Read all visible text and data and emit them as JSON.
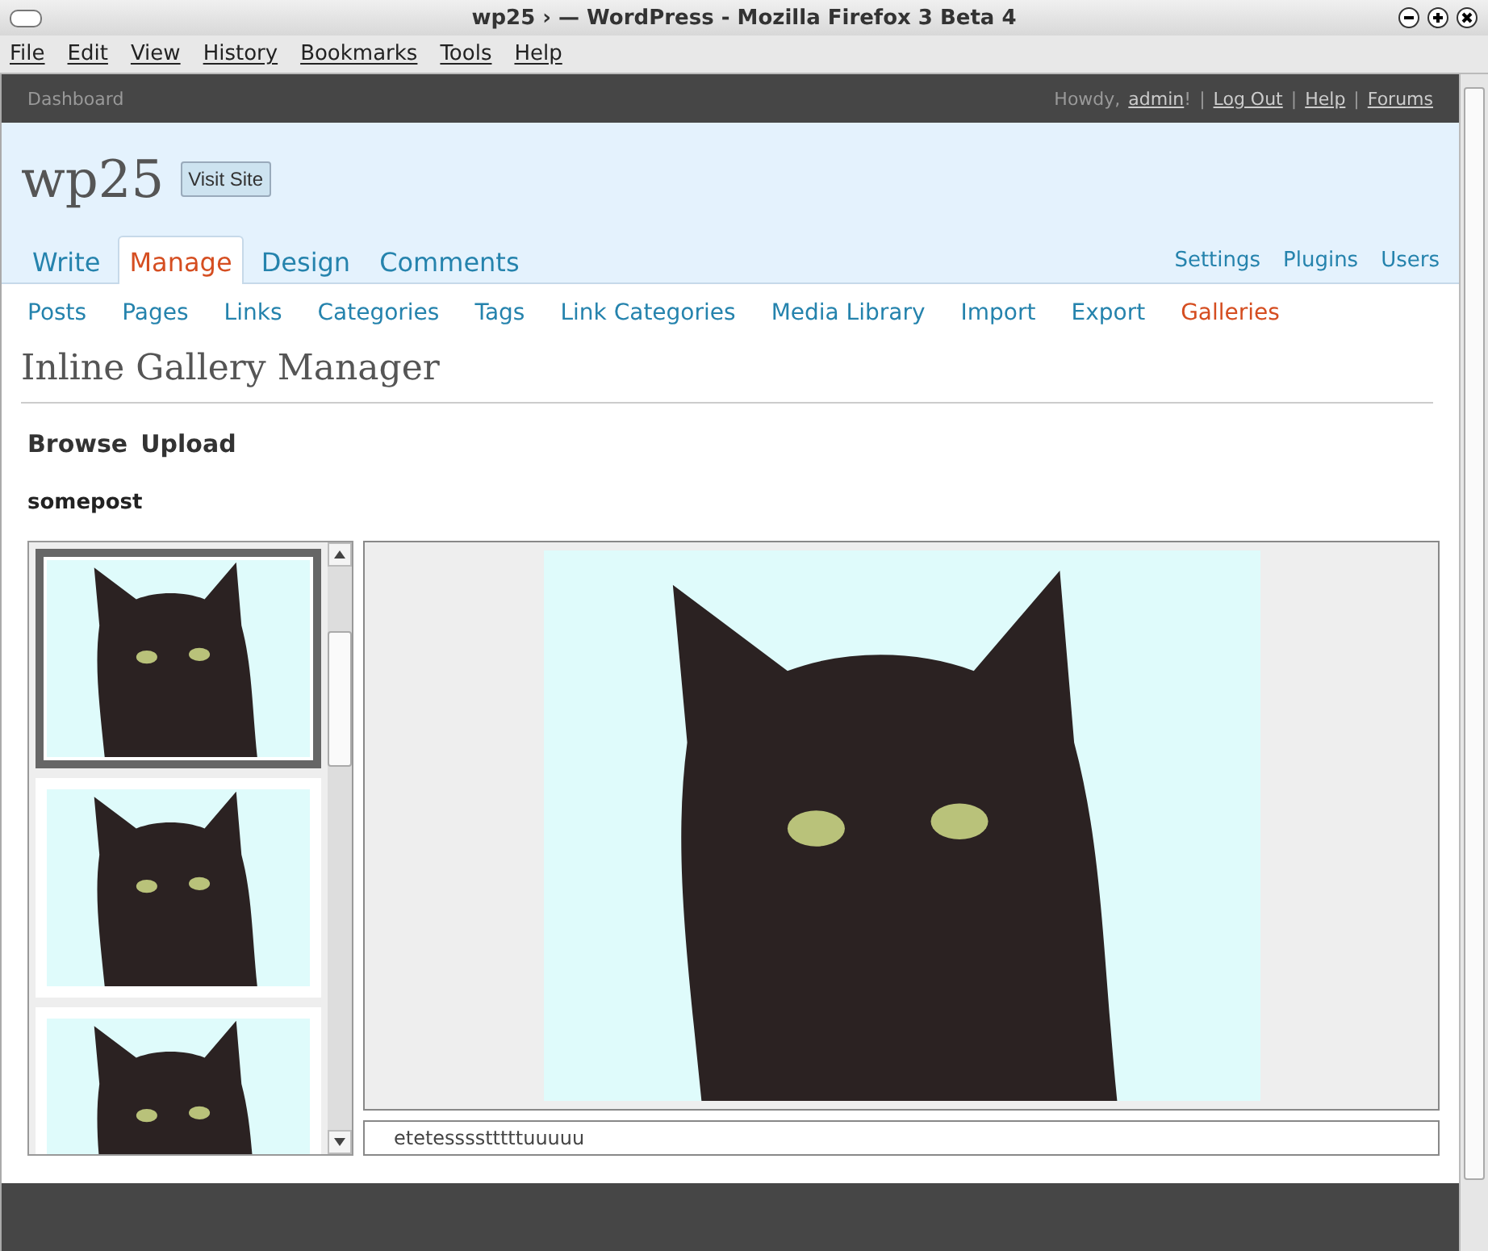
{
  "window": {
    "title": "wp25 › — WordPress - Mozilla Firefox 3 Beta 4"
  },
  "menu": [
    "File",
    "Edit",
    "View",
    "History",
    "Bookmarks",
    "Tools",
    "Help"
  ],
  "admin_bar": {
    "title": "Dashboard",
    "greeting": "Howdy,",
    "user": "admin",
    "user_suffix": "!",
    "separator": "|",
    "links": [
      "Log Out",
      "Help",
      "Forums"
    ]
  },
  "site": {
    "name": "wp25",
    "visit_button": "Visit Site"
  },
  "tabs": [
    {
      "label": "Write",
      "selected": false
    },
    {
      "label": "Manage",
      "selected": true
    },
    {
      "label": "Design",
      "selected": false
    },
    {
      "label": "Comments",
      "selected": false
    }
  ],
  "right_links": [
    "Settings",
    "Plugins",
    "Users"
  ],
  "subnav": [
    {
      "label": "Posts",
      "selected": false
    },
    {
      "label": "Pages",
      "selected": false
    },
    {
      "label": "Links",
      "selected": false
    },
    {
      "label": "Categories",
      "selected": false
    },
    {
      "label": "Tags",
      "selected": false
    },
    {
      "label": "Link Categories",
      "selected": false
    },
    {
      "label": "Media Library",
      "selected": false
    },
    {
      "label": "Import",
      "selected": false
    },
    {
      "label": "Export",
      "selected": false
    },
    {
      "label": "Galleries",
      "selected": true
    }
  ],
  "page_title": "Inline Gallery Manager",
  "view_links": [
    "Browse",
    "Upload"
  ],
  "post_title": "somepost",
  "thumbnails": [
    {
      "selected": true
    },
    {
      "selected": false
    },
    {
      "selected": false
    }
  ],
  "caption": {
    "value": "etetesssstttttuuuuu"
  }
}
